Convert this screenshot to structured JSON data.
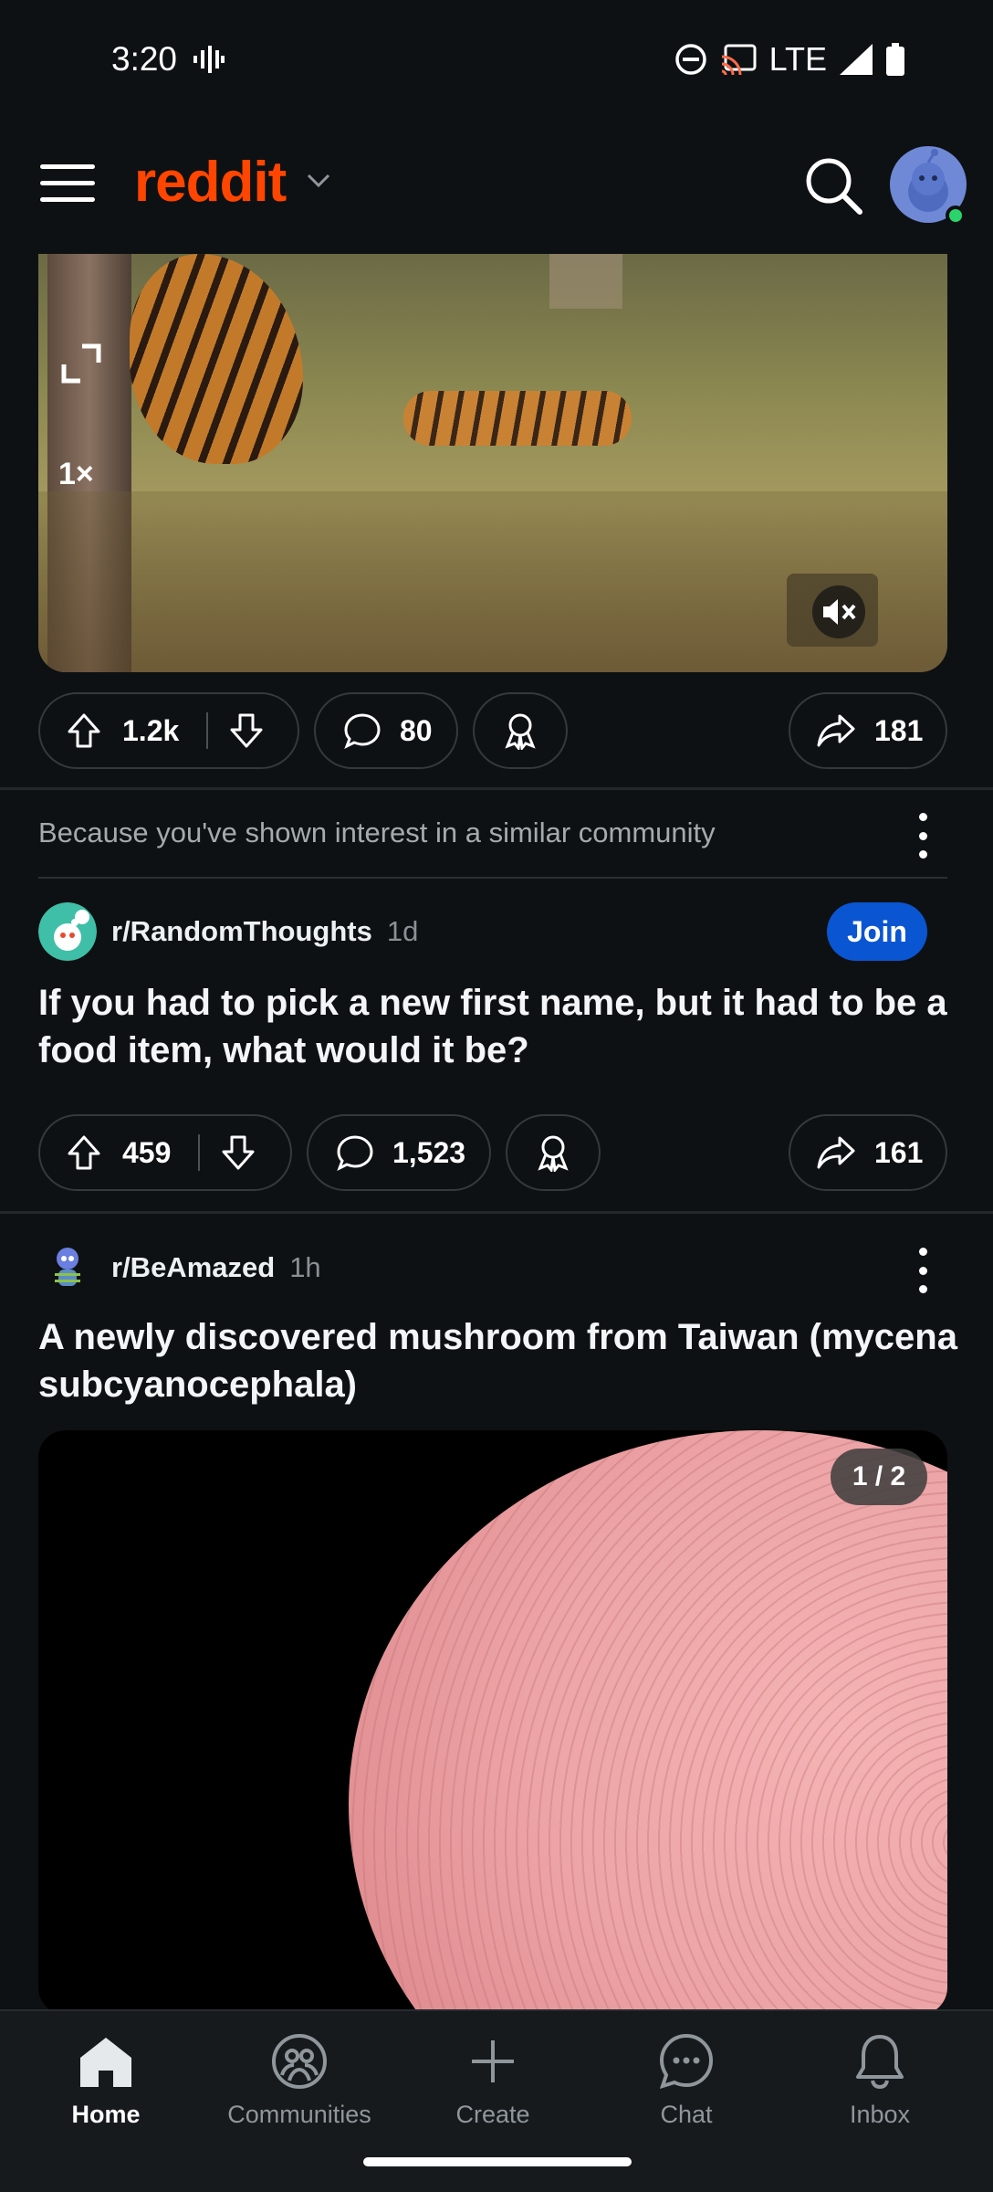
{
  "status_bar": {
    "time": "3:20",
    "network": "LTE"
  },
  "header": {
    "logo": "reddit"
  },
  "video_post": {
    "speed": "1×",
    "actions": {
      "upvotes": "1.2k",
      "comments": "80",
      "shares": "181"
    }
  },
  "recommendation": {
    "reason": "Because you've shown interest in a similar community"
  },
  "post1": {
    "subreddit": "r/RandomThoughts",
    "age": "1d",
    "join_label": "Join",
    "title": "If you had to pick a new first name, but it had to be a food item, what would it be?",
    "actions": {
      "upvotes": "459",
      "comments": "1,523",
      "shares": "161"
    }
  },
  "post2": {
    "subreddit": "r/BeAmazed",
    "age": "1h",
    "title": "A newly discovered mushroom from Taiwan (mycena subcyanocephala)",
    "gallery_counter": "1 / 2"
  },
  "bottom_nav": {
    "items": [
      {
        "label": "Home",
        "icon": "home-icon",
        "active": true
      },
      {
        "label": "Communities",
        "icon": "communities-icon",
        "active": false
      },
      {
        "label": "Create",
        "icon": "plus-icon",
        "active": false
      },
      {
        "label": "Chat",
        "icon": "chat-icon",
        "active": false
      },
      {
        "label": "Inbox",
        "icon": "bell-icon",
        "active": false
      }
    ]
  },
  "colors": {
    "brand": "#ff4500",
    "join_button": "#0a55d1",
    "background": "#0e1113"
  }
}
